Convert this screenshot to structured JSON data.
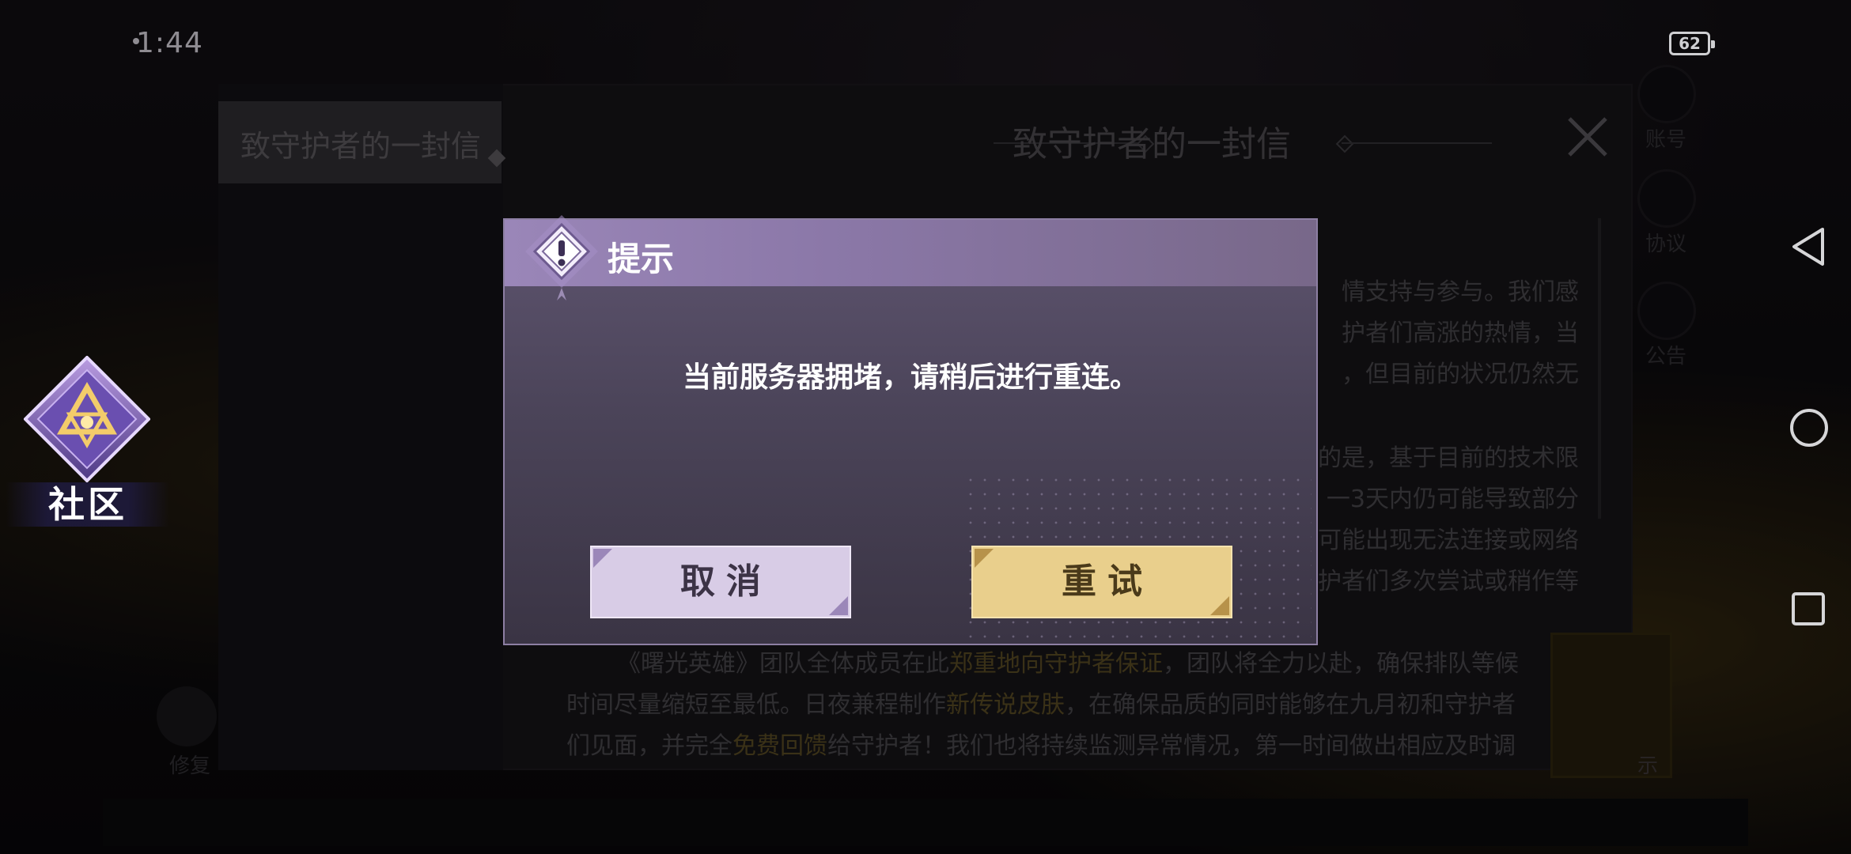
{
  "status_bar": {
    "time": "1:44",
    "battery": "62"
  },
  "community": {
    "label": "社区"
  },
  "letter": {
    "tab_label": "致守护者的一封信",
    "title": "致守护者的一封信",
    "lines": [
      "情支持与参与。我们感",
      "护者们高涨的热情，当",
      "，但目前的状况仍然无",
      "的是，基于目前的技术限",
      "一3天内仍可能导致部分",
      "可能出现无法连接或网络",
      "护者们多次尝试或稍作等"
    ],
    "para2_a": "《曙光英雄》团队全体成员在此",
    "para2_hl": "郑重地向守护者保证",
    "para2_b": "，团队将全力以赴，确保排队等候",
    "para3_a": "时间尽量缩短至最低。日夜兼程制作",
    "para3_hl": "新传说皮肤",
    "para3_b": "，在确保品质的同时能够在九月初和守护者",
    "para4_a": "们见面，并完全",
    "para4_hl": "免费回馈",
    "para4_b": "给守护者！我们也将持续监测异常情况，第一时间做出相应及时调"
  },
  "hud": {
    "labels": [
      "账号",
      "协议",
      "公告"
    ],
    "gold_label": "示",
    "tool_label": "修复"
  },
  "dialog": {
    "title": "提示",
    "message": "当前服务器拥堵，请稍后进行重连。",
    "cancel_label": "取消",
    "retry_label": "重试"
  },
  "colors": {
    "cancel_button": "#d8cce6",
    "retry_button": "#e9cf8c",
    "dialog_header": "#8b78a8"
  }
}
